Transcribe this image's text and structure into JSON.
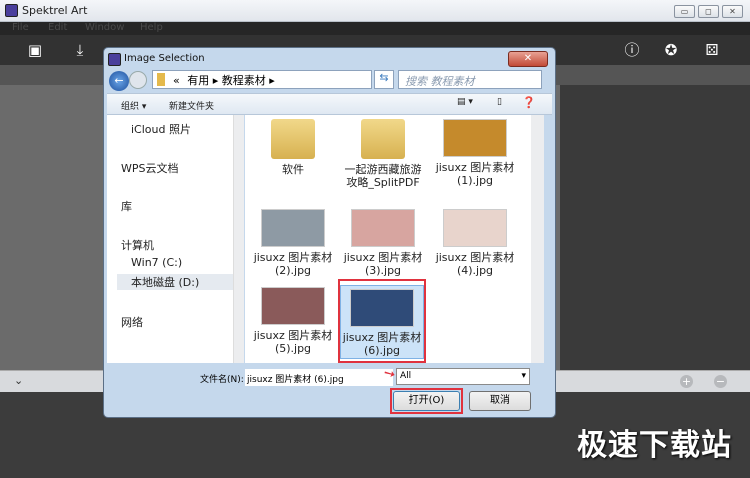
{
  "app": {
    "title": "Spektrel Art",
    "menu": [
      "File",
      "Edit",
      "Window",
      "Help"
    ],
    "window_buttons": [
      "▭",
      "◻",
      "✕"
    ]
  },
  "toolbar": {
    "left_icons": [
      "image-icon",
      "save-icon"
    ],
    "right_icons": [
      "info-icon",
      "settings-icon",
      "dice-icon"
    ]
  },
  "dialog": {
    "title": "Image Selection",
    "breadcrumb": [
      "«",
      "有用",
      "教程素材"
    ],
    "search_placeholder": "搜索 教程素材",
    "organize": "组织 ▾",
    "new_folder": "新建文件夹",
    "nav": [
      "iCloud 照片",
      "WPS云文档",
      "库",
      "计算机",
      "Win7 (C:)",
      "本地磁盘 (D:)",
      "网络"
    ],
    "files": [
      {
        "name": "软件",
        "type": "folder"
      },
      {
        "name": "一起游西藏旅游攻略_SplitPDF",
        "type": "folder"
      },
      {
        "name": "jisuxz 图片素材 (1).jpg",
        "type": "image",
        "color": "#c58a2c"
      },
      {
        "name": "jisuxz 图片素材 (2).jpg",
        "type": "image",
        "color": "#8e9aa4"
      },
      {
        "name": "jisuxz 图片素材 (3).jpg",
        "type": "image",
        "color": "#d7a5a0"
      },
      {
        "name": "jisuxz 图片素材 (4).jpg",
        "type": "image",
        "color": "#e8d4cc"
      },
      {
        "name": "jisuxz 图片素材 (5).jpg",
        "type": "image",
        "color": "#8a5a5a"
      },
      {
        "name": "jisuxz 图片素材 (6).jpg",
        "type": "image",
        "color": "#2f4b78",
        "selected": true
      }
    ],
    "filename_label": "文件名(N):",
    "filename_value": "jisuxz 图片素材 (6).jpg",
    "filter": "All",
    "open": "打开(O)",
    "cancel": "取消"
  },
  "watermark": "极速下载站"
}
